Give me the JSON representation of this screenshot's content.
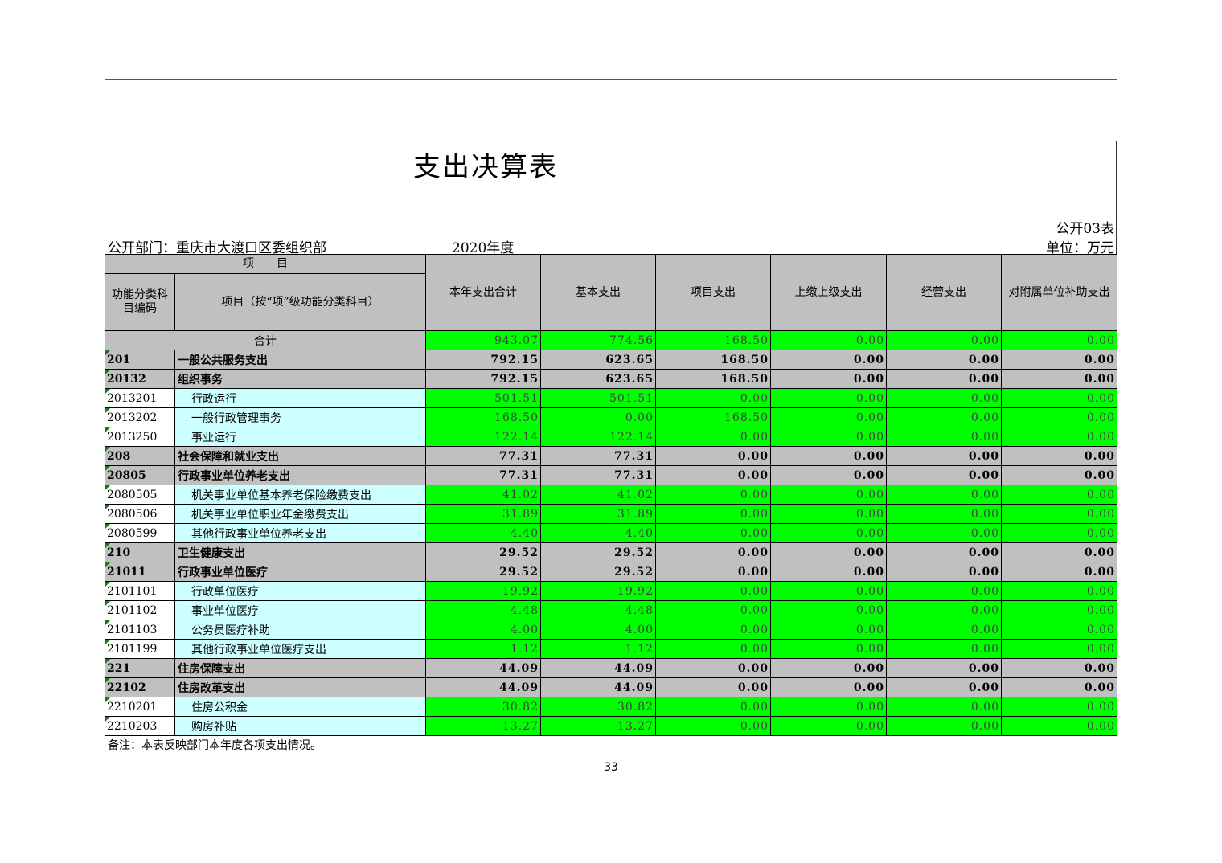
{
  "title": "支出决算表",
  "table_no": "公开03表",
  "unit": "单位：万元",
  "department": "公开部门：重庆市大渡口区委组织部",
  "year": "2020年度",
  "headers": {
    "item": "项　　目",
    "code": "功能分类科目编码",
    "name": "项目（按“项”级功能分类科目）",
    "total": "本年支出合计",
    "basic": "基本支出",
    "project": "项目支出",
    "upper": "上缴上级支出",
    "business": "经营支出",
    "subsidy": "对附属单位补助支出"
  },
  "total_row": {
    "label": "合计",
    "total": "943.07",
    "basic": "774.56",
    "project": "168.50",
    "upper": "0.00",
    "business": "0.00",
    "subsidy": "0.00"
  },
  "rows": [
    {
      "code": "201",
      "name": "一般公共服务支出",
      "total": "792.15",
      "basic": "623.65",
      "project": "168.50",
      "upper": "0.00",
      "business": "0.00",
      "subsidy": "0.00"
    },
    {
      "code": "20132",
      "name": "组织事务",
      "total": "792.15",
      "basic": "623.65",
      "project": "168.50",
      "upper": "0.00",
      "business": "0.00",
      "subsidy": "0.00"
    },
    {
      "code": "2013201",
      "name": "行政运行",
      "total": "501.51",
      "basic": "501.51",
      "project": "0.00",
      "upper": "0.00",
      "business": "0.00",
      "subsidy": "0.00"
    },
    {
      "code": "2013202",
      "name": "一般行政管理事务",
      "total": "168.50",
      "basic": "0.00",
      "project": "168.50",
      "upper": "0.00",
      "business": "0.00",
      "subsidy": "0.00"
    },
    {
      "code": "2013250",
      "name": "事业运行",
      "total": "122.14",
      "basic": "122.14",
      "project": "0.00",
      "upper": "0.00",
      "business": "0.00",
      "subsidy": "0.00"
    },
    {
      "code": "208",
      "name": "社会保障和就业支出",
      "total": "77.31",
      "basic": "77.31",
      "project": "0.00",
      "upper": "0.00",
      "business": "0.00",
      "subsidy": "0.00"
    },
    {
      "code": "20805",
      "name": "行政事业单位养老支出",
      "total": "77.31",
      "basic": "77.31",
      "project": "0.00",
      "upper": "0.00",
      "business": "0.00",
      "subsidy": "0.00"
    },
    {
      "code": "2080505",
      "name": "机关事业单位基本养老保险缴费支出",
      "total": "41.02",
      "basic": "41.02",
      "project": "0.00",
      "upper": "0.00",
      "business": "0.00",
      "subsidy": "0.00"
    },
    {
      "code": "2080506",
      "name": "机关事业单位职业年金缴费支出",
      "total": "31.89",
      "basic": "31.89",
      "project": "0.00",
      "upper": "0.00",
      "business": "0.00",
      "subsidy": "0.00"
    },
    {
      "code": "2080599",
      "name": "其他行政事业单位养老支出",
      "total": "4.40",
      "basic": "4.40",
      "project": "0.00",
      "upper": "0.00",
      "business": "0.00",
      "subsidy": "0.00"
    },
    {
      "code": "210",
      "name": "卫生健康支出",
      "total": "29.52",
      "basic": "29.52",
      "project": "0.00",
      "upper": "0.00",
      "business": "0.00",
      "subsidy": "0.00"
    },
    {
      "code": "21011",
      "name": "行政事业单位医疗",
      "total": "29.52",
      "basic": "29.52",
      "project": "0.00",
      "upper": "0.00",
      "business": "0.00",
      "subsidy": "0.00"
    },
    {
      "code": "2101101",
      "name": "行政单位医疗",
      "total": "19.92",
      "basic": "19.92",
      "project": "0.00",
      "upper": "0.00",
      "business": "0.00",
      "subsidy": "0.00"
    },
    {
      "code": "2101102",
      "name": "事业单位医疗",
      "total": "4.48",
      "basic": "4.48",
      "project": "0.00",
      "upper": "0.00",
      "business": "0.00",
      "subsidy": "0.00"
    },
    {
      "code": "2101103",
      "name": "公务员医疗补助",
      "total": "4.00",
      "basic": "4.00",
      "project": "0.00",
      "upper": "0.00",
      "business": "0.00",
      "subsidy": "0.00"
    },
    {
      "code": "2101199",
      "name": "其他行政事业单位医疗支出",
      "total": "1.12",
      "basic": "1.12",
      "project": "0.00",
      "upper": "0.00",
      "business": "0.00",
      "subsidy": "0.00"
    },
    {
      "code": "221",
      "name": "住房保障支出",
      "total": "44.09",
      "basic": "44.09",
      "project": "0.00",
      "upper": "0.00",
      "business": "0.00",
      "subsidy": "0.00"
    },
    {
      "code": "22102",
      "name": "住房改革支出",
      "total": "44.09",
      "basic": "44.09",
      "project": "0.00",
      "upper": "0.00",
      "business": "0.00",
      "subsidy": "0.00"
    },
    {
      "code": "2210201",
      "name": "住房公积金",
      "total": "30.82",
      "basic": "30.82",
      "project": "0.00",
      "upper": "0.00",
      "business": "0.00",
      "subsidy": "0.00"
    },
    {
      "code": "2210203",
      "name": "购房补贴",
      "total": "13.27",
      "basic": "13.27",
      "project": "0.00",
      "upper": "0.00",
      "business": "0.00",
      "subsidy": "0.00"
    }
  ],
  "note": "备注：本表反映部门本年度各项支出情况。",
  "page_number": "33",
  "colors": {
    "green": "#00ff00",
    "cyan": "#ccffff",
    "gray": "#c0c0c0"
  }
}
